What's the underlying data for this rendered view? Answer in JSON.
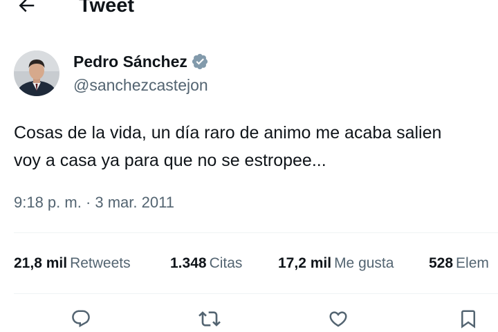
{
  "header": {
    "title": "Tweet",
    "back_icon": "arrow-left-icon"
  },
  "author": {
    "name": "Pedro Sánchez",
    "handle": "@sanchezcastejon",
    "verified_icon": "verified-badge-icon",
    "verified_color": "#829aab"
  },
  "tweet": {
    "line1": "Cosas de la vida, un día raro de animo me acaba salien",
    "line2": "voy a casa ya para que no se estropee...",
    "timestamp": "9:18 p. m. · 3 mar. 2011"
  },
  "stats": [
    {
      "value": "21,8 mil",
      "label": "Retweets"
    },
    {
      "value": "1.348",
      "label": "Citas"
    },
    {
      "value": "17,2 mil",
      "label": "Me gusta"
    },
    {
      "value": "528",
      "label": "Elem"
    }
  ],
  "actions": [
    {
      "icon": "reply-icon"
    },
    {
      "icon": "retweet-icon"
    },
    {
      "icon": "like-icon"
    },
    {
      "icon": "bookmark-icon"
    }
  ],
  "colors": {
    "text": "#0f1419",
    "secondary": "#536471",
    "divider": "#eff3f4"
  }
}
